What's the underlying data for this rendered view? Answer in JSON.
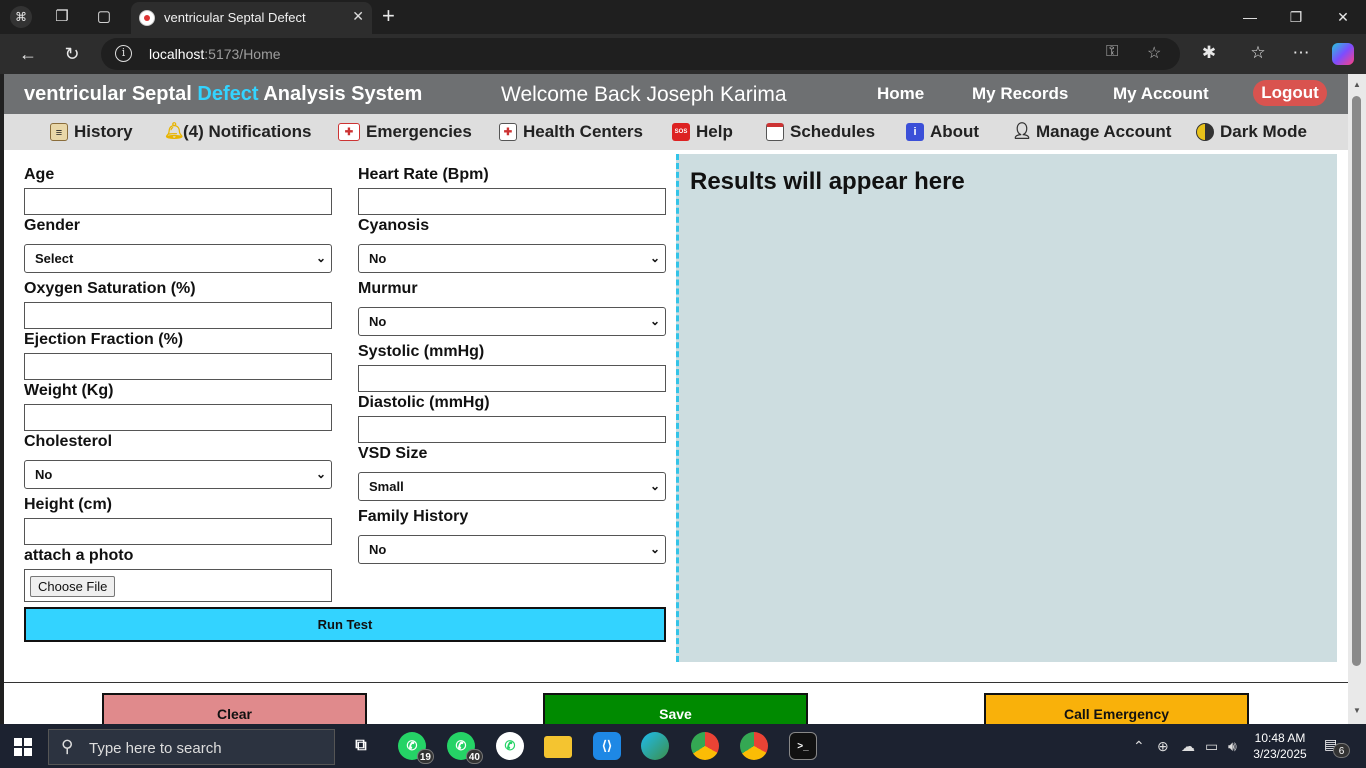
{
  "browser": {
    "tab_title": "ventricular Septal Defect",
    "url_host": "localhost",
    "url_path": ":5173/Home"
  },
  "app": {
    "brand_part1": "ventricular Septal ",
    "brand_accent": "Defect",
    "brand_part2": " Analysis System",
    "welcome": "Welcome Back Joseph Karima",
    "nav": {
      "home": "Home",
      "records": "My Records",
      "account": "My Account",
      "logout": "Logout"
    },
    "accent_color": "#33d3ff"
  },
  "subnav": {
    "history": "History",
    "notifications": "(4) Notifications",
    "emergencies": "Emergencies",
    "health_centers": "Health Centers",
    "help": "Help",
    "help_icon_text": "SOS",
    "schedules": "Schedules",
    "about": "About",
    "about_icon_text": "i",
    "manage_account": "Manage Account",
    "dark_mode": "Dark Mode"
  },
  "form": {
    "age": {
      "label": "Age",
      "value": ""
    },
    "gender": {
      "label": "Gender",
      "value": "Select"
    },
    "oxygen": {
      "label": "Oxygen Saturation (%)",
      "value": ""
    },
    "ejection": {
      "label": "Ejection Fraction (%)",
      "value": ""
    },
    "weight": {
      "label": "Weight (Kg)",
      "value": ""
    },
    "cholesterol": {
      "label": "Cholesterol",
      "value": "No"
    },
    "height": {
      "label": "Height (cm)",
      "value": ""
    },
    "photo": {
      "label": "attach a photo",
      "button": "Choose File"
    },
    "heart_rate": {
      "label": "Heart Rate (Bpm)",
      "value": ""
    },
    "cyanosis": {
      "label": "Cyanosis",
      "value": "No"
    },
    "murmur": {
      "label": "Murmur",
      "value": "No"
    },
    "systolic": {
      "label": "Systolic (mmHg)",
      "value": ""
    },
    "diastolic": {
      "label": "Diastolic (mmHg)",
      "value": ""
    },
    "vsd_size": {
      "label": "VSD Size",
      "value": "Small"
    },
    "family_history": {
      "label": "Family History",
      "value": "No"
    },
    "run_test": "Run Test"
  },
  "results": {
    "title": "Results will appear here"
  },
  "actions": {
    "clear": "Clear",
    "save": "Save",
    "call_emergency": "Call Emergency",
    "clear_color": "#e08a8c",
    "save_color": "#008a00",
    "emergency_color": "#f9b10a"
  },
  "taskbar": {
    "search_placeholder": "Type here to search",
    "whatsapp1_badge": "19",
    "whatsapp2_badge": "40",
    "time": "10:48 AM",
    "date": "3/23/2025",
    "notifications_badge": "6"
  }
}
